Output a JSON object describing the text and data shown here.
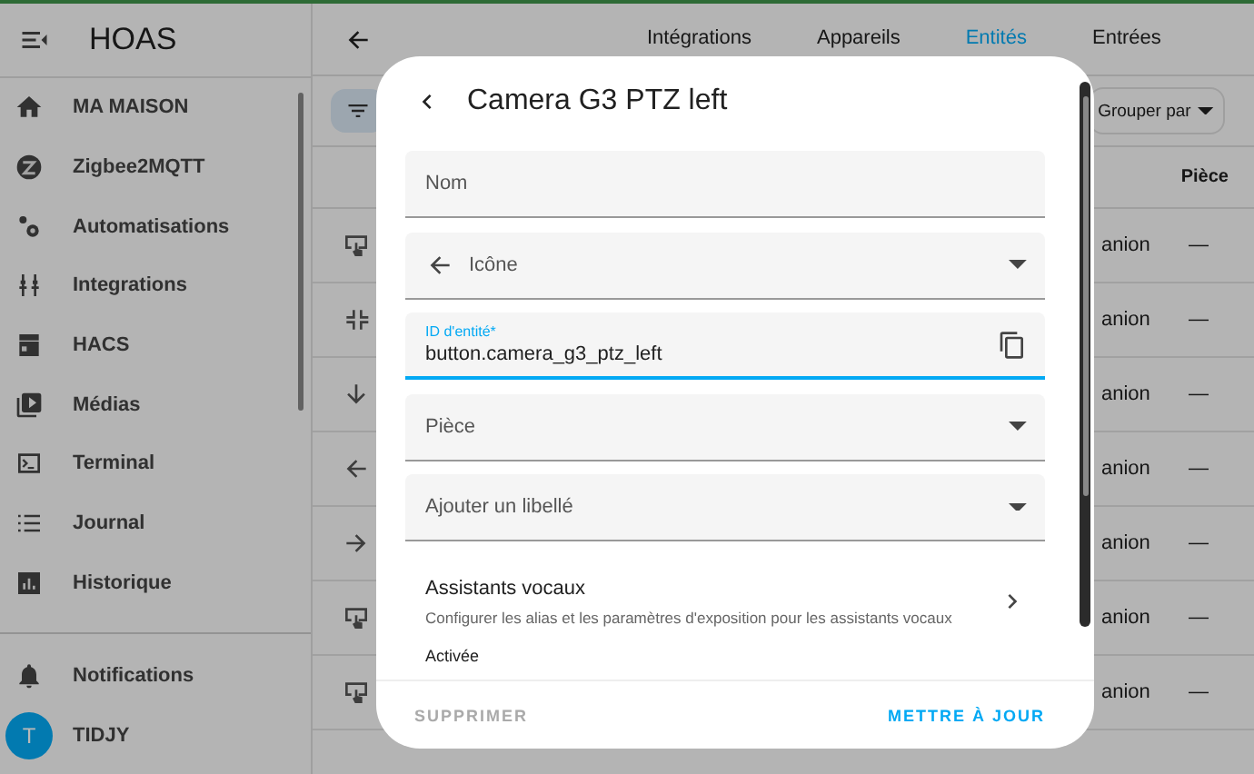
{
  "sidebar": {
    "title": "HOAS",
    "items": [
      {
        "label": "MA MAISON"
      },
      {
        "label": "Zigbee2MQTT"
      },
      {
        "label": "Automatisations"
      },
      {
        "label": "Integrations"
      },
      {
        "label": "HACS"
      },
      {
        "label": "Médias"
      },
      {
        "label": "Terminal"
      },
      {
        "label": "Journal"
      },
      {
        "label": "Historique"
      }
    ],
    "notifications": "Notifications",
    "user": {
      "initial": "T",
      "name": "TIDJY"
    }
  },
  "tabs": [
    {
      "label": "Intégrations",
      "selected": false
    },
    {
      "label": "Appareils",
      "selected": false
    },
    {
      "label": "Entités",
      "selected": true
    },
    {
      "label": "Entrées",
      "selected": false
    }
  ],
  "toolbar": {
    "group_by": "Grouper par"
  },
  "table": {
    "columns": [
      {
        "label": "Pièce"
      }
    ],
    "rows": [
      {
        "column_1": "anion",
        "area": "—"
      },
      {
        "column_1": "anion",
        "area": "—"
      },
      {
        "column_1": "anion",
        "area": "—"
      },
      {
        "column_1": "anion",
        "area": "—"
      },
      {
        "column_1": "anion",
        "area": "—"
      },
      {
        "column_1": "anion",
        "area": "—"
      },
      {
        "column_1": "anion",
        "area": "—"
      }
    ]
  },
  "dialog": {
    "title": "Camera G3 PTZ left",
    "fields": [
      {
        "kind": "text",
        "label": "Nom",
        "focused": false
      },
      {
        "kind": "icon-select",
        "label": "Icône",
        "focused": false
      },
      {
        "kind": "copyable",
        "label": "ID d'entité*",
        "value": "button.camera_g3_ptz_left",
        "focused": true
      },
      {
        "kind": "select",
        "label": "Pièce",
        "focused": false
      },
      {
        "kind": "select",
        "label": "Ajouter un libellé",
        "focused": false
      }
    ],
    "voice": {
      "title": "Assistants vocaux",
      "subtitle": "Configurer les alias et les paramètres d'exposition pour les assistants vocaux"
    },
    "enabled_label": "Activée",
    "buttons": [
      {
        "label": "SUPPRIMER",
        "disabled": true
      },
      {
        "label": "METTRE À JOUR",
        "disabled": false
      }
    ]
  }
}
